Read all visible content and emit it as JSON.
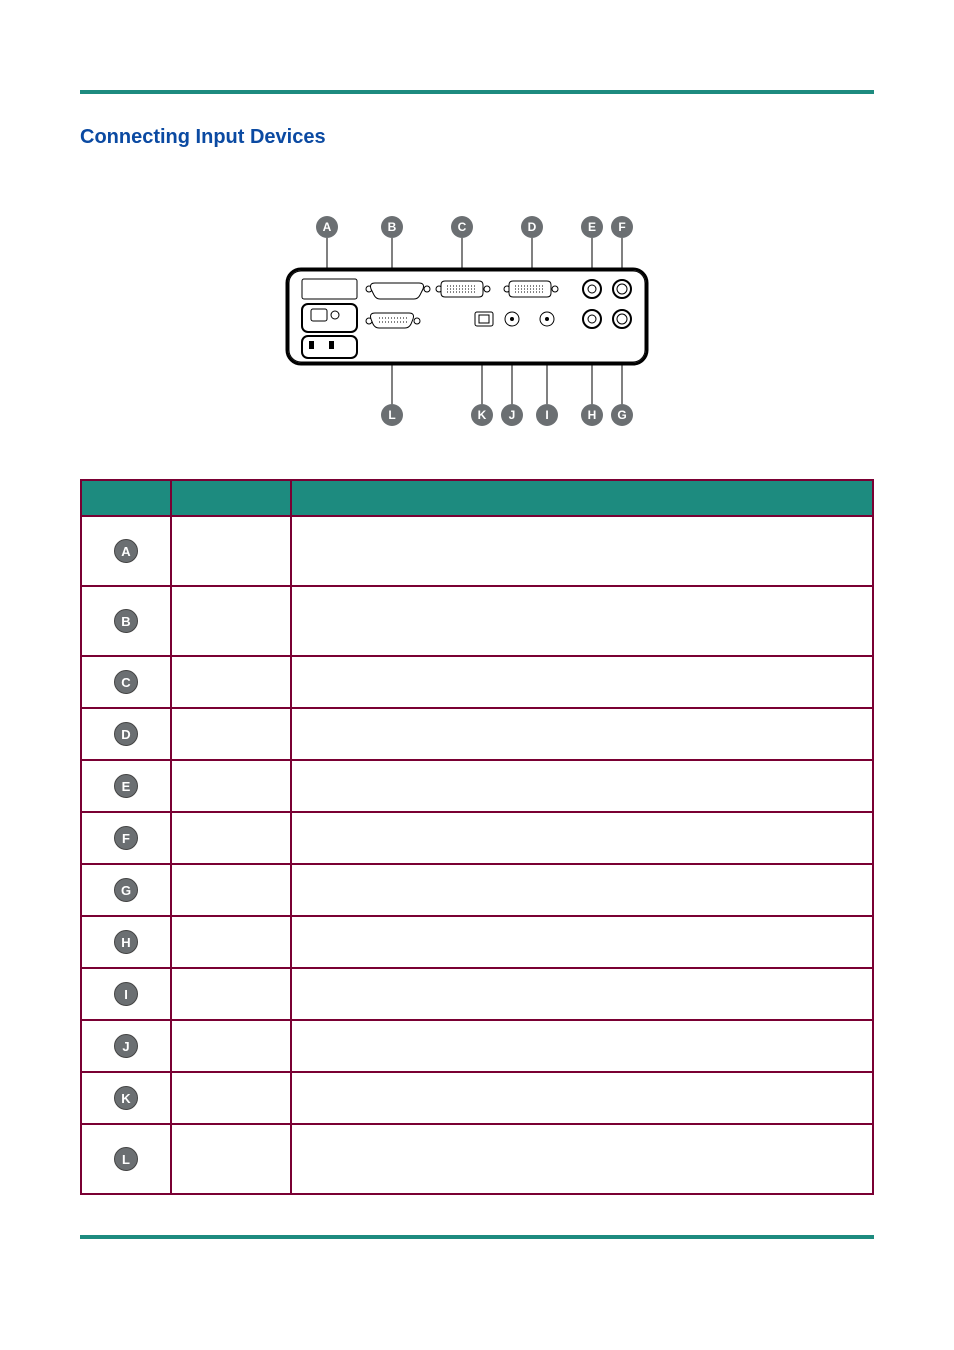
{
  "section_title": "Connecting Input Devices",
  "diagram_callouts_top": [
    "A",
    "B",
    "C",
    "D",
    "E",
    "F"
  ],
  "diagram_callouts_bottom": [
    "L",
    "K",
    "J",
    "I",
    "H",
    "G"
  ],
  "table": {
    "headers": [
      "",
      "",
      ""
    ],
    "rows": [
      {
        "badge": "A"
      },
      {
        "badge": "B"
      },
      {
        "badge": "C"
      },
      {
        "badge": "D"
      },
      {
        "badge": "E"
      },
      {
        "badge": "F"
      },
      {
        "badge": "G"
      },
      {
        "badge": "H"
      },
      {
        "badge": "I"
      },
      {
        "badge": "J"
      },
      {
        "badge": "K"
      },
      {
        "badge": "L"
      }
    ]
  }
}
